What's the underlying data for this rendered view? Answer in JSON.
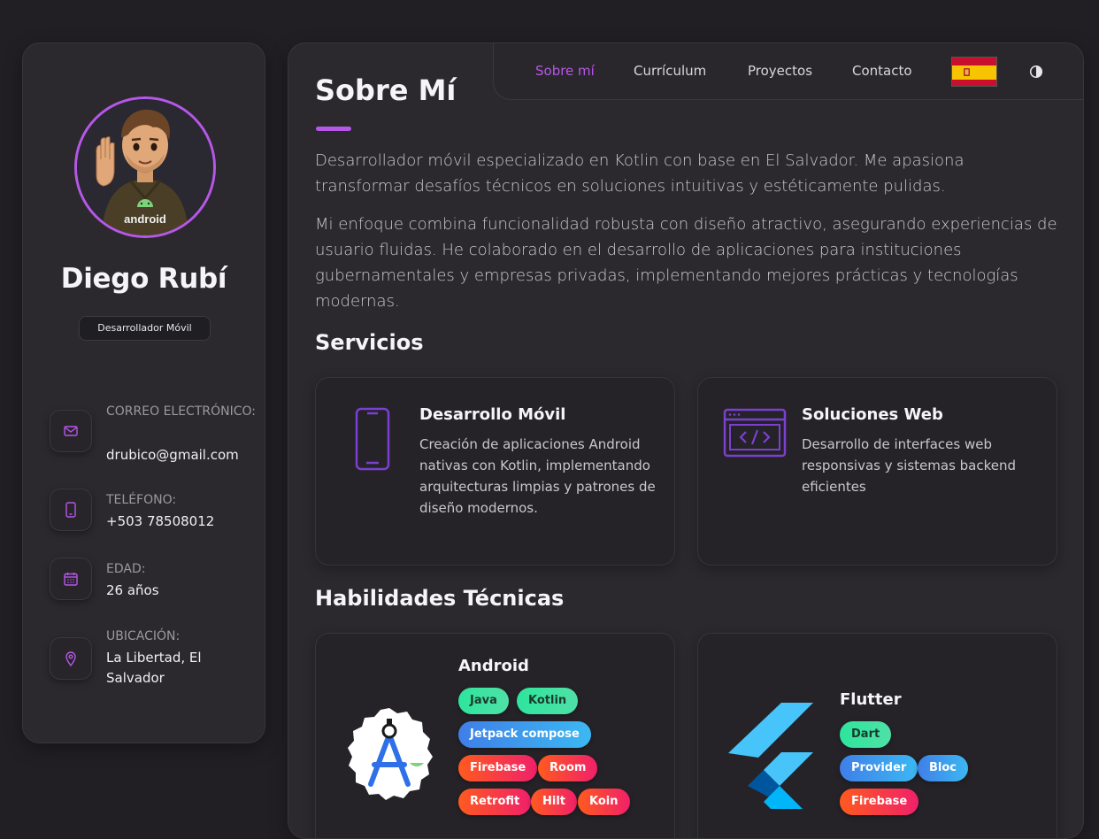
{
  "profile": {
    "name": "Diego Rubí",
    "role": "Desarrollador Móvil",
    "avatar_text": "android"
  },
  "contacts": [
    {
      "label": "CORREO ELECTRÓNICO:",
      "value": "drubico@gmail.com",
      "icon": "mail-icon"
    },
    {
      "label": "TELÉFONO:",
      "value": "+503 78508012",
      "icon": "phone-icon"
    },
    {
      "label": "EDAD:",
      "value": "26 años",
      "icon": "calendar-icon"
    },
    {
      "label": "UBICACIÓN:",
      "value": "La Libertad, El Salvador",
      "icon": "location-icon"
    }
  ],
  "nav": {
    "items": [
      "Sobre mí",
      "Currículum",
      "Proyectos",
      "Contacto"
    ],
    "active": "Sobre mí",
    "flag": "spain-flag-icon",
    "theme_toggle": "contrast-icon"
  },
  "about": {
    "title": "Sobre Mí",
    "paragraphs": [
      "Desarrollador móvil especializado en Kotlin con base en El Salvador. Me apasiona transformar desafíos técnicos en soluciones intuitivas y estéticamente pulidas.",
      "Mi enfoque combina funcionalidad robusta con diseño atractivo, asegurando experiencias de usuario fluidas. He colaborado en el desarrollo de aplicaciones para instituciones gubernamentales y empresas privadas, implementando mejores prácticas y tecnologías modernas."
    ]
  },
  "services": {
    "title": "Servicios",
    "items": [
      {
        "title": "Desarrollo Móvil",
        "description": "Creación de aplicaciones Android nativas con Kotlin, implementando arquitecturas limpias y patrones de diseño modernos.",
        "icon": "smartphone-icon"
      },
      {
        "title": "Soluciones Web",
        "description": "Desarrollo de interfaces web responsivas y sistemas backend eficientes",
        "icon": "code-window-icon"
      }
    ]
  },
  "skills": {
    "title": "Habilidades Técnicas",
    "groups": [
      {
        "title": "Android",
        "icon": "android-studio-icon",
        "tags": [
          "Java",
          "Kotlin",
          "Jetpack compose",
          "Firebase",
          "Room",
          "Retrofit",
          "Hilt",
          "Koin"
        ]
      },
      {
        "title": "Flutter",
        "icon": "flutter-icon",
        "tags": [
          "Dart",
          "Provider",
          "Bloc",
          "Firebase"
        ]
      }
    ]
  },
  "colors": {
    "accent": "#b657e8",
    "background": "#211f24",
    "card": "#2b292e"
  }
}
